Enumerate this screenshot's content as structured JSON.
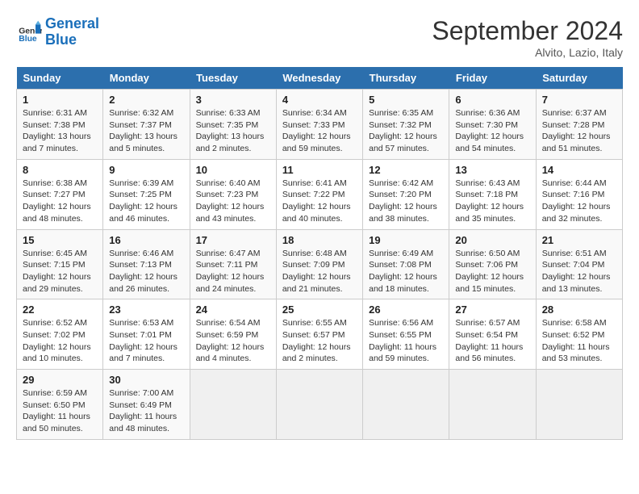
{
  "header": {
    "logo_line1": "General",
    "logo_line2": "Blue",
    "month_title": "September 2024",
    "location": "Alvito, Lazio, Italy"
  },
  "weekdays": [
    "Sunday",
    "Monday",
    "Tuesday",
    "Wednesday",
    "Thursday",
    "Friday",
    "Saturday"
  ],
  "weeks": [
    [
      {
        "day": "1",
        "info": "Sunrise: 6:31 AM\nSunset: 7:38 PM\nDaylight: 13 hours and 7 minutes."
      },
      {
        "day": "2",
        "info": "Sunrise: 6:32 AM\nSunset: 7:37 PM\nDaylight: 13 hours and 5 minutes."
      },
      {
        "day": "3",
        "info": "Sunrise: 6:33 AM\nSunset: 7:35 PM\nDaylight: 13 hours and 2 minutes."
      },
      {
        "day": "4",
        "info": "Sunrise: 6:34 AM\nSunset: 7:33 PM\nDaylight: 12 hours and 59 minutes."
      },
      {
        "day": "5",
        "info": "Sunrise: 6:35 AM\nSunset: 7:32 PM\nDaylight: 12 hours and 57 minutes."
      },
      {
        "day": "6",
        "info": "Sunrise: 6:36 AM\nSunset: 7:30 PM\nDaylight: 12 hours and 54 minutes."
      },
      {
        "day": "7",
        "info": "Sunrise: 6:37 AM\nSunset: 7:28 PM\nDaylight: 12 hours and 51 minutes."
      }
    ],
    [
      {
        "day": "8",
        "info": "Sunrise: 6:38 AM\nSunset: 7:27 PM\nDaylight: 12 hours and 48 minutes."
      },
      {
        "day": "9",
        "info": "Sunrise: 6:39 AM\nSunset: 7:25 PM\nDaylight: 12 hours and 46 minutes."
      },
      {
        "day": "10",
        "info": "Sunrise: 6:40 AM\nSunset: 7:23 PM\nDaylight: 12 hours and 43 minutes."
      },
      {
        "day": "11",
        "info": "Sunrise: 6:41 AM\nSunset: 7:22 PM\nDaylight: 12 hours and 40 minutes."
      },
      {
        "day": "12",
        "info": "Sunrise: 6:42 AM\nSunset: 7:20 PM\nDaylight: 12 hours and 38 minutes."
      },
      {
        "day": "13",
        "info": "Sunrise: 6:43 AM\nSunset: 7:18 PM\nDaylight: 12 hours and 35 minutes."
      },
      {
        "day": "14",
        "info": "Sunrise: 6:44 AM\nSunset: 7:16 PM\nDaylight: 12 hours and 32 minutes."
      }
    ],
    [
      {
        "day": "15",
        "info": "Sunrise: 6:45 AM\nSunset: 7:15 PM\nDaylight: 12 hours and 29 minutes."
      },
      {
        "day": "16",
        "info": "Sunrise: 6:46 AM\nSunset: 7:13 PM\nDaylight: 12 hours and 26 minutes."
      },
      {
        "day": "17",
        "info": "Sunrise: 6:47 AM\nSunset: 7:11 PM\nDaylight: 12 hours and 24 minutes."
      },
      {
        "day": "18",
        "info": "Sunrise: 6:48 AM\nSunset: 7:09 PM\nDaylight: 12 hours and 21 minutes."
      },
      {
        "day": "19",
        "info": "Sunrise: 6:49 AM\nSunset: 7:08 PM\nDaylight: 12 hours and 18 minutes."
      },
      {
        "day": "20",
        "info": "Sunrise: 6:50 AM\nSunset: 7:06 PM\nDaylight: 12 hours and 15 minutes."
      },
      {
        "day": "21",
        "info": "Sunrise: 6:51 AM\nSunset: 7:04 PM\nDaylight: 12 hours and 13 minutes."
      }
    ],
    [
      {
        "day": "22",
        "info": "Sunrise: 6:52 AM\nSunset: 7:02 PM\nDaylight: 12 hours and 10 minutes."
      },
      {
        "day": "23",
        "info": "Sunrise: 6:53 AM\nSunset: 7:01 PM\nDaylight: 12 hours and 7 minutes."
      },
      {
        "day": "24",
        "info": "Sunrise: 6:54 AM\nSunset: 6:59 PM\nDaylight: 12 hours and 4 minutes."
      },
      {
        "day": "25",
        "info": "Sunrise: 6:55 AM\nSunset: 6:57 PM\nDaylight: 12 hours and 2 minutes."
      },
      {
        "day": "26",
        "info": "Sunrise: 6:56 AM\nSunset: 6:55 PM\nDaylight: 11 hours and 59 minutes."
      },
      {
        "day": "27",
        "info": "Sunrise: 6:57 AM\nSunset: 6:54 PM\nDaylight: 11 hours and 56 minutes."
      },
      {
        "day": "28",
        "info": "Sunrise: 6:58 AM\nSunset: 6:52 PM\nDaylight: 11 hours and 53 minutes."
      }
    ],
    [
      {
        "day": "29",
        "info": "Sunrise: 6:59 AM\nSunset: 6:50 PM\nDaylight: 11 hours and 50 minutes."
      },
      {
        "day": "30",
        "info": "Sunrise: 7:00 AM\nSunset: 6:49 PM\nDaylight: 11 hours and 48 minutes."
      },
      {
        "day": "",
        "info": ""
      },
      {
        "day": "",
        "info": ""
      },
      {
        "day": "",
        "info": ""
      },
      {
        "day": "",
        "info": ""
      },
      {
        "day": "",
        "info": ""
      }
    ]
  ]
}
